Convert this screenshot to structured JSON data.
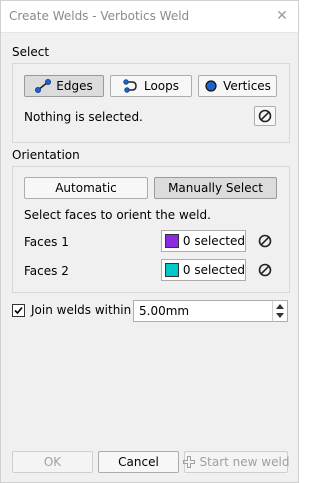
{
  "window": {
    "title": "Create Welds - Verbotics Weld",
    "close_glyph": "✕"
  },
  "select": {
    "label": "Select",
    "buttons": {
      "edges": "Edges",
      "loops": "Loops",
      "vertices": "Vertices"
    },
    "status": "Nothing is selected."
  },
  "orientation": {
    "label": "Orientation",
    "buttons": {
      "automatic": "Automatic",
      "manual": "Manually Select"
    },
    "hint": "Select faces to orient the weld.",
    "faces": [
      {
        "label": "Faces 1",
        "value": "0 selected",
        "color": "#8a2be2"
      },
      {
        "label": "Faces 2",
        "value": "0 selected",
        "color": "#00c8c8"
      }
    ]
  },
  "join": {
    "label": "Join welds within",
    "checked": true,
    "value": "5.00mm"
  },
  "footer": {
    "ok": "OK",
    "cancel": "Cancel",
    "start": "Start new weld"
  },
  "colors": {
    "accent_blue": "#1e64c8"
  }
}
